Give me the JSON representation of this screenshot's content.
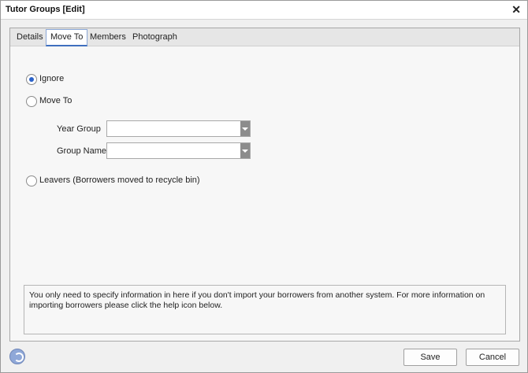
{
  "window": {
    "title": "Tutor Groups [Edit]"
  },
  "tabs": [
    {
      "label": "Details"
    },
    {
      "label": "Move To"
    },
    {
      "label": "Members"
    },
    {
      "label": "Photograph"
    }
  ],
  "active_tab": "Move To",
  "options": {
    "ignore_label": "Ignore",
    "move_to_label": "Move To",
    "leavers_label": "Leavers (Borrowers moved to recycle bin)",
    "selected": "Ignore"
  },
  "fields": {
    "year_group_label": "Year Group",
    "year_group_value": "",
    "group_name_label": "Group Name",
    "group_name_value": ""
  },
  "info_text": "You only need to specify information in here if you don't import your borrowers from another system. For more information on importing borrowers please click the help icon below.",
  "buttons": {
    "save": "Save",
    "cancel": "Cancel"
  },
  "icons": {
    "close": "close-icon",
    "help": "help-icon",
    "dropdown": "chevron-down-icon"
  }
}
